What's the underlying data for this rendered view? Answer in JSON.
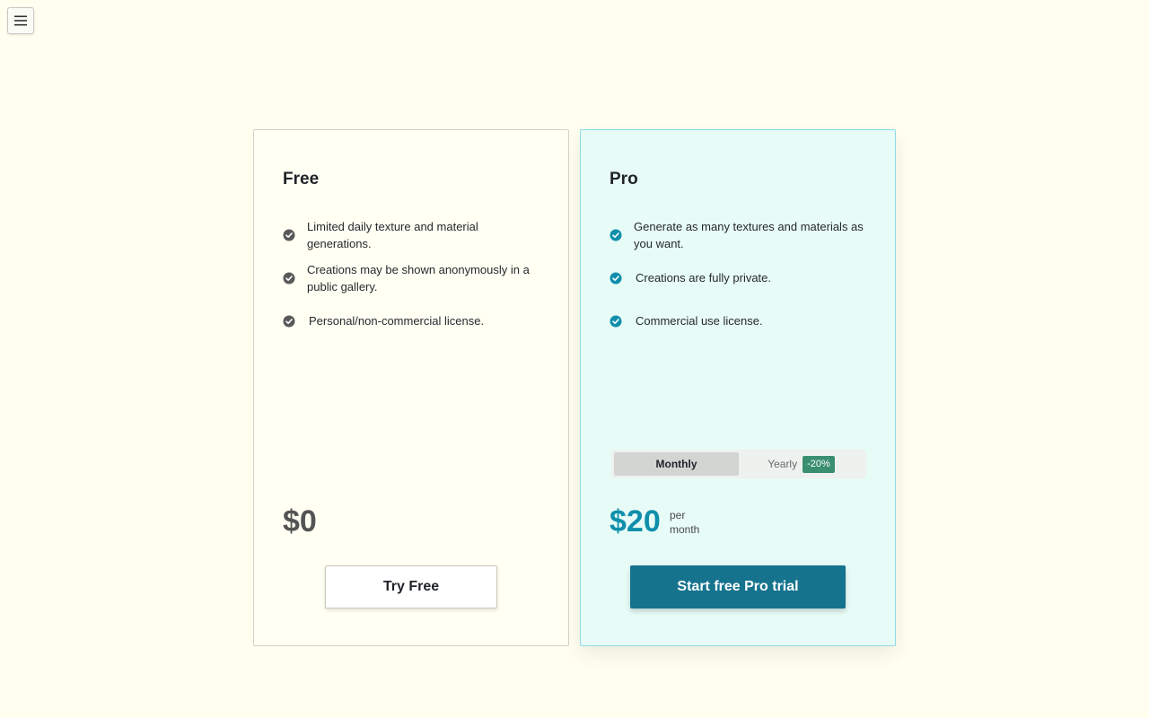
{
  "menu": {
    "icon": "hamburger-menu-icon"
  },
  "plans": {
    "free": {
      "title": "Free",
      "features": [
        "Limited daily texture and material generations.",
        "Creations may be shown anonymously in a public gallery.",
        "Personal/non-commercial license."
      ],
      "price": "$0",
      "cta": "Try Free",
      "check_color": "#595959"
    },
    "pro": {
      "title": "Pro",
      "features": [
        "Generate as many textures and materials as you want.",
        "Creations are fully private.",
        "Commercial use license."
      ],
      "billing": {
        "monthly_label": "Monthly",
        "yearly_label": "Yearly",
        "yearly_discount": "-20%",
        "selected": "Monthly"
      },
      "price": "$20",
      "per_line1": "per",
      "per_line2": "month",
      "cta": "Start free Pro trial",
      "check_color": "#0f8fab"
    }
  },
  "colors": {
    "page_bg": "#fffeef",
    "pro_accent": "#0f8fab",
    "pro_button": "#16738e",
    "discount_badge": "#3a8f71"
  }
}
